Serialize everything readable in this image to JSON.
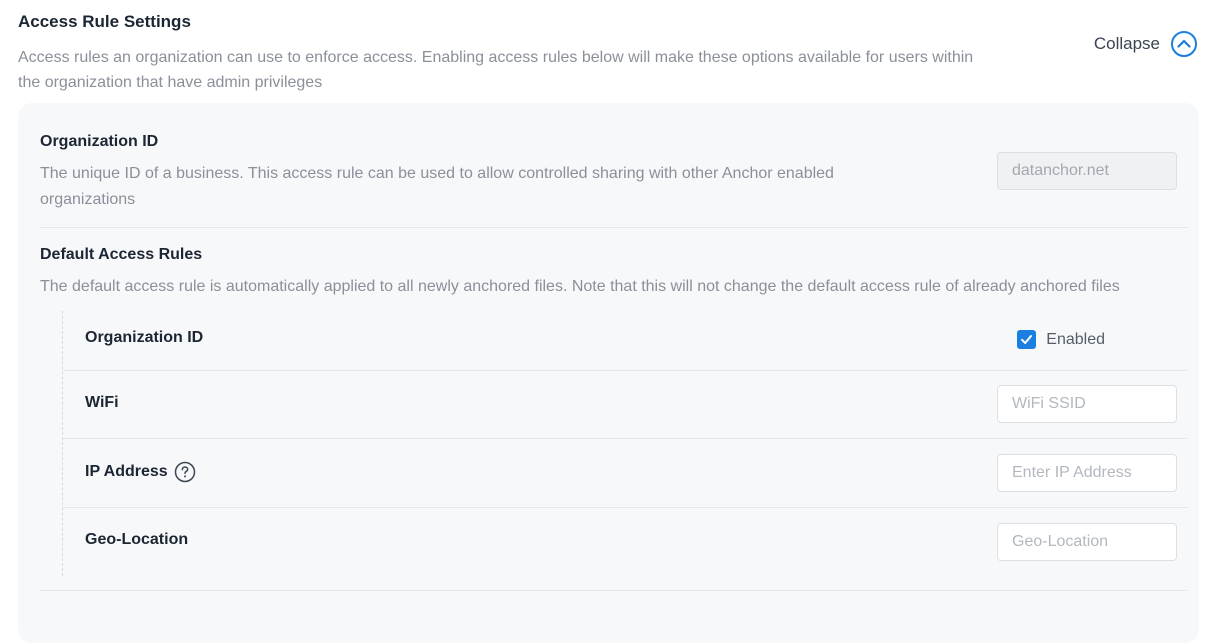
{
  "header": {
    "title": "Access Rule Settings",
    "description": "Access rules an organization can use to enforce access. Enabling access rules below will make these options available for users within the organization that have admin privileges",
    "collapse_label": "Collapse",
    "collapse_icon": "chevron-up-circle-icon"
  },
  "organization": {
    "title": "Organization ID",
    "description": "The unique ID of a business. This access rule can be used to allow controlled sharing with other Anchor enabled organizations",
    "value": "datanchor.net"
  },
  "default_rules": {
    "title": "Default Access Rules",
    "description": "The default access rule is automatically applied to all newly anchored files. Note that this will not change the default access rule of already anchored files",
    "rules": [
      {
        "label": "Organization ID",
        "control": "checkbox",
        "checked": true,
        "checkbox_label": "Enabled"
      },
      {
        "label": "WiFi",
        "control": "input",
        "placeholder": "WiFi SSID",
        "value": ""
      },
      {
        "label": "IP Address",
        "control": "input",
        "placeholder": "Enter IP Address",
        "value": "",
        "help_icon": "question-circle-icon"
      },
      {
        "label": "Geo-Location",
        "control": "input",
        "placeholder": "Geo-Location",
        "value": ""
      }
    ]
  },
  "colors": {
    "accent": "#1a7fe0",
    "panel_bg": "#f7f8fa",
    "muted_text": "#8a9099"
  }
}
